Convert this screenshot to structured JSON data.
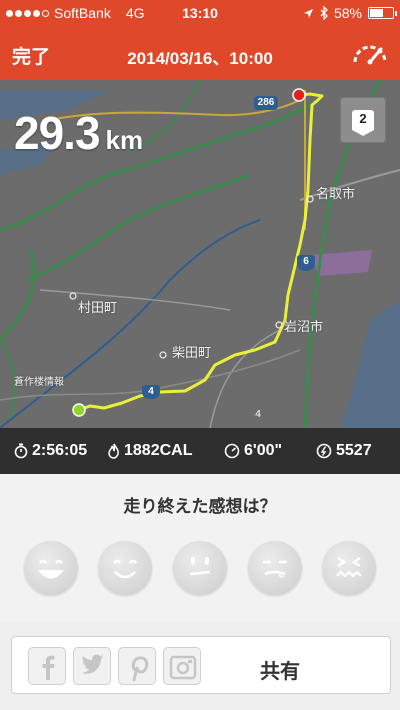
{
  "status_bar": {
    "carrier": "SoftBank",
    "network": "4G",
    "time": "13:10",
    "battery": "58%",
    "battery_level": 0.58
  },
  "nav": {
    "done_label": "完了",
    "title": "2014/03/16、10:00",
    "gauge_icon": "speedometer-icon"
  },
  "map": {
    "distance_value": "29.3",
    "distance_unit": "km",
    "lap_count": "2",
    "labels": {
      "natori": "名取市",
      "iwanuma": "岩沼市",
      "murata": "村田町",
      "shibata": "柴田町",
      "start_area": "蒼作楼情報"
    },
    "route_shields": {
      "r286": "286",
      "r6": "6",
      "r4": "4",
      "bottom": "4"
    },
    "colors": {
      "route": "#e8f03a",
      "start_marker": "#8fd62a",
      "end_marker": "#e0241c",
      "road_green": "#3b8c4e",
      "road_yellow": "#c8a93a",
      "water": "#4f6b8a"
    }
  },
  "stats": {
    "duration": "2:56:05",
    "calories": "1882CAL",
    "pace": "6'00\"",
    "fuel": "5527"
  },
  "feeling": {
    "question": "走り終えた感想は？",
    "faces": [
      "awesome-face-icon",
      "happy-face-icon",
      "neutral-face-icon",
      "tired-face-icon",
      "injured-face-icon"
    ]
  },
  "share": {
    "label": "共有",
    "icons": [
      "facebook-icon",
      "twitter-icon",
      "pinterest-icon",
      "camera-icon"
    ]
  }
}
